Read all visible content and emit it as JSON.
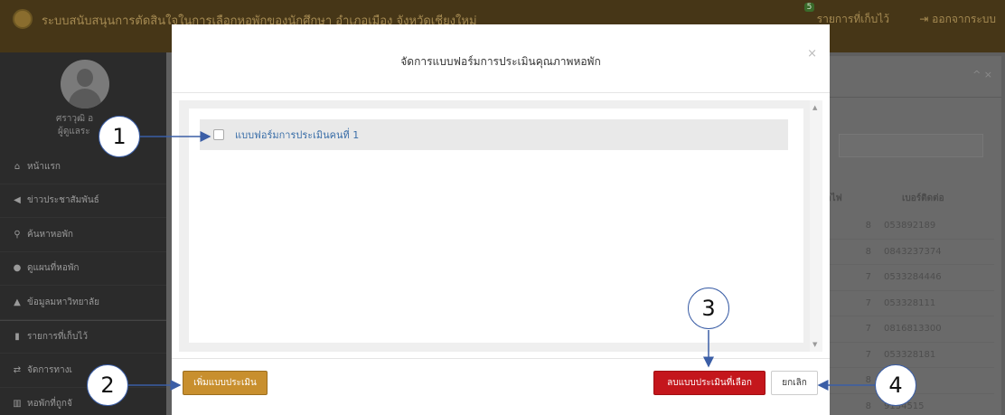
{
  "topbar": {
    "app_title": "ระบบสนับสนุนการตัดสินใจในการเลือกหอพักของนักศึกษา อำเภอเมือง จังหวัดเชียงใหม่",
    "saved_count": "5",
    "saved_label": "รายการที่เก็บไว้",
    "logout_label": "ออกจากระบบ"
  },
  "sidebar": {
    "user_name": "ศราวุฒิ อ",
    "user_role": "ผู้ดูแลระ",
    "items": [
      {
        "icon": "home-icon",
        "glyph": "⌂",
        "label": "หน้าแรก"
      },
      {
        "icon": "megaphone-icon",
        "glyph": "◀",
        "label": "ข่าวประชาสัมพันธ์"
      },
      {
        "icon": "search-icon",
        "glyph": "⚲",
        "label": "ค้นหาหอพัก"
      },
      {
        "icon": "map-marker-icon",
        "glyph": "●",
        "label": "ดูแผนที่หอพัก"
      },
      {
        "icon": "graduation-cap-icon",
        "glyph": "▲",
        "label": "ข้อมูลมหาวิทยาลัย"
      },
      {
        "icon": "bookmark-icon",
        "glyph": "▮",
        "label": "รายการที่เก็บไว้"
      },
      {
        "icon": "exchange-icon",
        "glyph": "⇄",
        "label": "จัดการทางเ"
      },
      {
        "icon": "bar-chart-icon",
        "glyph": "▥",
        "label": "หอพักที่ถูกจั"
      }
    ]
  },
  "table": {
    "col1_header": "าไฟ",
    "col2_header": "เบอร์ติดต่อ",
    "rows": [
      {
        "col1": "8",
        "phone": "053892189"
      },
      {
        "col1": "8",
        "phone": "0843237374"
      },
      {
        "col1": "7",
        "phone": "0533284446"
      },
      {
        "col1": "7",
        "phone": "053328111"
      },
      {
        "col1": "7",
        "phone": "0816813300"
      },
      {
        "col1": "7",
        "phone": "053328181"
      },
      {
        "col1": "8",
        "phone": "3549"
      },
      {
        "col1": "8",
        "phone": "9134515"
      }
    ]
  },
  "modal": {
    "title": "จัดการแบบฟอร์มการประเมินคุณภาพหอพัก",
    "close_symbol": "×",
    "list_items": [
      {
        "label": "แบบฟอร์มการประเมินคนที่ 1",
        "checked": false
      }
    ],
    "add_button": "เพิ่มแบบประเมิน",
    "delete_button": "ลบแบบประเมินที่เลือก",
    "cancel_button": "ยกเลิก"
  },
  "callouts": [
    "1",
    "2",
    "3",
    "4"
  ],
  "colors": {
    "add_button": "#c88f2e",
    "delete_button": "#c4161c",
    "callout_border": "#3b5ea6",
    "link_text": "#3a6ea8"
  }
}
